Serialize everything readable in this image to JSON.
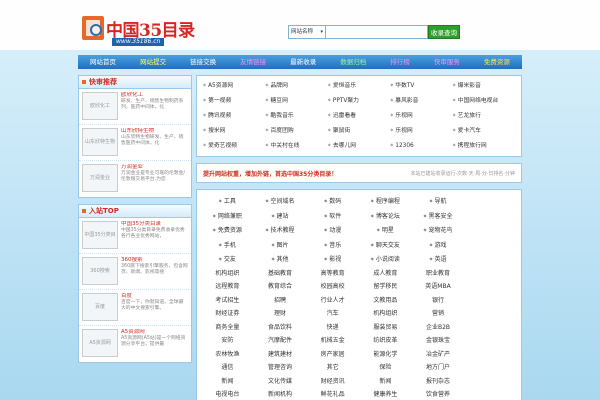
{
  "header": {
    "logo_title": "中国35目录",
    "logo_url": "www.35186.cn"
  },
  "search": {
    "select_value": "网站名称",
    "input_value": "",
    "button_label": "收录查询"
  },
  "nav": {
    "items": [
      {
        "label": "网站首页",
        "style": ""
      },
      {
        "label": "网站提交",
        "style": "hl-yellow"
      },
      {
        "label": "链接交换",
        "style": ""
      },
      {
        "label": "友情链接",
        "style": "hl-pink"
      },
      {
        "label": "最新收录",
        "style": ""
      },
      {
        "label": "数据归档",
        "style": "hl-green"
      },
      {
        "label": "排行榜",
        "style": "hl-pink"
      },
      {
        "label": "快审服务",
        "style": "hl-pink"
      },
      {
        "label": "免费资源",
        "style": "hl-amber"
      }
    ]
  },
  "sidebar": {
    "fast_title": "快审推荐",
    "fast_items": [
      {
        "thumb": "欧欣化工",
        "name": "欧欣化工",
        "desc": "研发、生产、销售生物制药系列，医药中间体，化"
      },
      {
        "thumb": "山东欣特生物",
        "name": "山东欣特生物",
        "desc": "山东欣特生物研发、生产、销售医药中间体，化"
      },
      {
        "thumb": "万润金业",
        "name": "万润金业",
        "desc": "万润金业是专业可靠的伦敦金/伦敦银交易平台,为您"
      }
    ],
    "top_title": "入站TOP",
    "top_items": [
      {
        "thumb": "中国35分类目录",
        "name": "中国35分类目录",
        "desc": "中国35分类目录免费收录优秀各行各业优秀网站，"
      },
      {
        "thumb": "360搜索",
        "name": "360搜索",
        "desc": "360旗下搜索引擎服务，包含网页、新闻、影视等搜"
      },
      {
        "thumb": "百度",
        "name": "百度",
        "desc": "百度一下，你就知道。全球最大的中文搜索引擎。"
      },
      {
        "thumb": "A5资源网",
        "name": "A5资源网",
        "desc": "A5资源网(A5站)是一个网络资源分享平台，提供最"
      }
    ]
  },
  "links": [
    "A5资源网",
    "品牌网",
    "爱恒音乐",
    "华数TV",
    "爆米影音",
    "第一视频",
    "糖豆网",
    "PPTV聚力",
    "暴风影音",
    "中国网络电视台",
    "腾讯视频",
    "酷我音乐",
    "迅雷看看",
    "乐视网",
    "艺龙旅行",
    "搜米网",
    "百度团购",
    "聚鼠街",
    "乐视网",
    "爱卡汽车",
    "爱奇艺视频",
    "中关村在线",
    "去哪儿网",
    "12306",
    "携程旅行网"
  ],
  "notice": {
    "text": "提升网站权重，增加外链，首选中国35分类目录！",
    "stats": "本站已建站收录运行·次数·天·周·分·日排名·分钟"
  },
  "categories": [
    {
      "label": "工具",
      "dot": true
    },
    {
      "label": "空间域名",
      "dot": true
    },
    {
      "label": "数码",
      "dot": true
    },
    {
      "label": "程序编程",
      "dot": true
    },
    {
      "label": "导航",
      "dot": true
    },
    {
      "label": "",
      "dot": false
    },
    {
      "label": "网络兼职",
      "dot": true
    },
    {
      "label": "建站",
      "dot": true
    },
    {
      "label": "软件",
      "dot": true
    },
    {
      "label": "博客论坛",
      "dot": true
    },
    {
      "label": "黑客安全",
      "dot": true
    },
    {
      "label": "",
      "dot": false
    },
    {
      "label": "免费资源",
      "dot": true
    },
    {
      "label": "技术教程",
      "dot": true
    },
    {
      "label": "动漫",
      "dot": true
    },
    {
      "label": "明星",
      "dot": true
    },
    {
      "label": "宠物花鸟",
      "dot": true
    },
    {
      "label": "",
      "dot": false
    },
    {
      "label": "手机",
      "dot": true
    },
    {
      "label": "图片",
      "dot": true
    },
    {
      "label": "音乐",
      "dot": true
    },
    {
      "label": "聊天交友",
      "dot": true
    },
    {
      "label": "游戏",
      "dot": true
    },
    {
      "label": "",
      "dot": false
    },
    {
      "label": "交友",
      "dot": true
    },
    {
      "label": "其他",
      "dot": true
    },
    {
      "label": "影视",
      "dot": true
    },
    {
      "label": "小说阅读",
      "dot": true
    },
    {
      "label": "英语",
      "dot": true
    },
    {
      "label": "",
      "dot": false
    },
    {
      "label": "机构组织",
      "dot": false
    },
    {
      "label": "基础教育",
      "dot": false
    },
    {
      "label": "高等教育",
      "dot": false
    },
    {
      "label": "成人教育",
      "dot": false
    },
    {
      "label": "职业教育",
      "dot": false
    },
    {
      "label": "",
      "dot": false
    },
    {
      "label": "远程教育",
      "dot": false
    },
    {
      "label": "教育综合",
      "dot": false
    },
    {
      "label": "校园高校",
      "dot": false
    },
    {
      "label": "留学移民",
      "dot": false
    },
    {
      "label": "英语MBA",
      "dot": false
    },
    {
      "label": "",
      "dot": false
    },
    {
      "label": "考试招生",
      "dot": false
    },
    {
      "label": "招聘",
      "dot": false
    },
    {
      "label": "行业人才",
      "dot": false
    },
    {
      "label": "文教用品",
      "dot": false
    },
    {
      "label": "银行",
      "dot": false
    },
    {
      "label": "",
      "dot": false
    },
    {
      "label": "财经证券",
      "dot": false
    },
    {
      "label": "理财",
      "dot": false
    },
    {
      "label": "汽车",
      "dot": false
    },
    {
      "label": "机构组织",
      "dot": false
    },
    {
      "label": "营销",
      "dot": false
    },
    {
      "label": "",
      "dot": false
    },
    {
      "label": "商务全量",
      "dot": false
    },
    {
      "label": "食品饮料",
      "dot": false
    },
    {
      "label": "快递",
      "dot": false
    },
    {
      "label": "服装贸易",
      "dot": false
    },
    {
      "label": "企业B2B",
      "dot": false
    },
    {
      "label": "",
      "dot": false
    },
    {
      "label": "安防",
      "dot": false
    },
    {
      "label": "汽摩配件",
      "dot": false
    },
    {
      "label": "机械五金",
      "dot": false
    },
    {
      "label": "纺织皮革",
      "dot": false
    },
    {
      "label": "金银珠宝",
      "dot": false
    },
    {
      "label": "",
      "dot": false
    },
    {
      "label": "农林牧渔",
      "dot": false
    },
    {
      "label": "建筑建材",
      "dot": false
    },
    {
      "label": "房产家居",
      "dot": false
    },
    {
      "label": "能源化学",
      "dot": false
    },
    {
      "label": "冶金矿产",
      "dot": false
    },
    {
      "label": "",
      "dot": false
    },
    {
      "label": "通信",
      "dot": false
    },
    {
      "label": "管理咨询",
      "dot": false
    },
    {
      "label": "其它",
      "dot": false
    },
    {
      "label": "保险",
      "dot": false
    },
    {
      "label": "地方门户",
      "dot": false
    },
    {
      "label": "",
      "dot": false
    },
    {
      "label": "新闻",
      "dot": false
    },
    {
      "label": "文化传媒",
      "dot": false
    },
    {
      "label": "财经资讯",
      "dot": false
    },
    {
      "label": "新闻",
      "dot": false
    },
    {
      "label": "报刊杂志",
      "dot": false
    },
    {
      "label": "",
      "dot": false
    },
    {
      "label": "电视电台",
      "dot": false
    },
    {
      "label": "新闻机构",
      "dot": false
    },
    {
      "label": "鲜花礼品",
      "dot": false
    },
    {
      "label": "健康养生",
      "dot": false
    },
    {
      "label": "饮食营养",
      "dot": false
    },
    {
      "label": "",
      "dot": false
    }
  ]
}
